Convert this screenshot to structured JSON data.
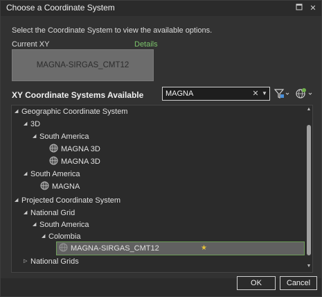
{
  "window": {
    "title": "Choose a Coordinate System",
    "maximize_icon": "maximize-icon",
    "close_icon": "close-icon"
  },
  "instruction": "Select the Coordinate System to view the available options.",
  "current": {
    "label": "Current XY",
    "details_link": "Details",
    "value": "MAGNA-SIRGAS_CMT12"
  },
  "available": {
    "title": "XY Coordinate Systems Available"
  },
  "search": {
    "value": "MAGNA",
    "clear_icon": "clear-icon",
    "dropdown_icon": "chevron-down-icon"
  },
  "toolbar": {
    "filter_icon": "filter-icon",
    "add_icon": "globe-add-icon"
  },
  "tree": {
    "geographic": "Geographic Coordinate System",
    "geo_3d": "3D",
    "geo_3d_sa": "South America",
    "magna_3d_1": "MAGNA 3D",
    "magna_3d_2": "MAGNA 3D",
    "geo_sa": "South America",
    "magna": "MAGNA",
    "projected": "Projected Coordinate System",
    "national_grid": "National Grid",
    "proj_sa": "South America",
    "colombia": "Colombia",
    "selected_item": "MAGNA-SIRGAS_CMT12",
    "national_grids": "National Grids"
  },
  "buttons": {
    "ok": "OK",
    "cancel": "Cancel"
  },
  "colors": {
    "accent_green": "#7cc46b",
    "favorite_star": "#e6c23a"
  }
}
